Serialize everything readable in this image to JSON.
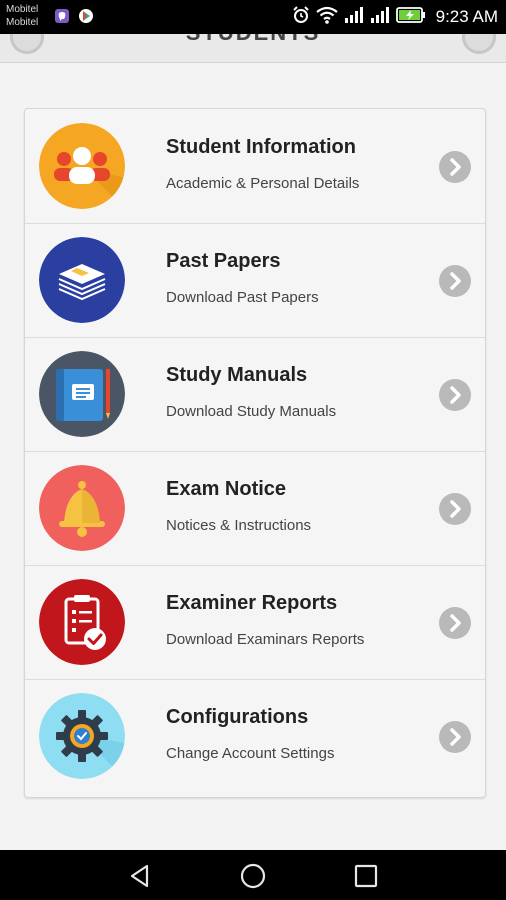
{
  "status_bar": {
    "carrier_1": "Mobitel",
    "carrier_2": "Mobitel",
    "time": "9:23 AM",
    "icons": [
      "viber-icon",
      "play-store-icon",
      "alarm-icon",
      "wifi-icon",
      "signal-icon",
      "signal-icon",
      "battery-charging-icon"
    ]
  },
  "header": {
    "title": "STUDENTS"
  },
  "menu": {
    "items": [
      {
        "title": "Student Information",
        "subtitle": "Academic & Personal Details",
        "icon": "students-group-icon",
        "color": "#F5A623"
      },
      {
        "title": "Past Papers",
        "subtitle": "Download Past Papers",
        "icon": "paper-stack-icon",
        "color": "#2B3FA0"
      },
      {
        "title": "Study Manuals",
        "subtitle": "Download Study Manuals",
        "icon": "notebook-icon",
        "color": "#4A5566"
      },
      {
        "title": "Exam Notice",
        "subtitle": "Notices & Instructions",
        "icon": "bell-icon",
        "color": "#F0615E"
      },
      {
        "title": "Examiner Reports",
        "subtitle": "Download Examinars Reports",
        "icon": "report-checklist-icon",
        "color": "#C0161C"
      },
      {
        "title": "Configurations",
        "subtitle": "Change Account Settings",
        "icon": "settings-gear-icon",
        "color": "#8FDDF2"
      }
    ]
  },
  "nav_bar": {
    "buttons": [
      "back-icon",
      "home-icon",
      "recents-icon"
    ]
  }
}
